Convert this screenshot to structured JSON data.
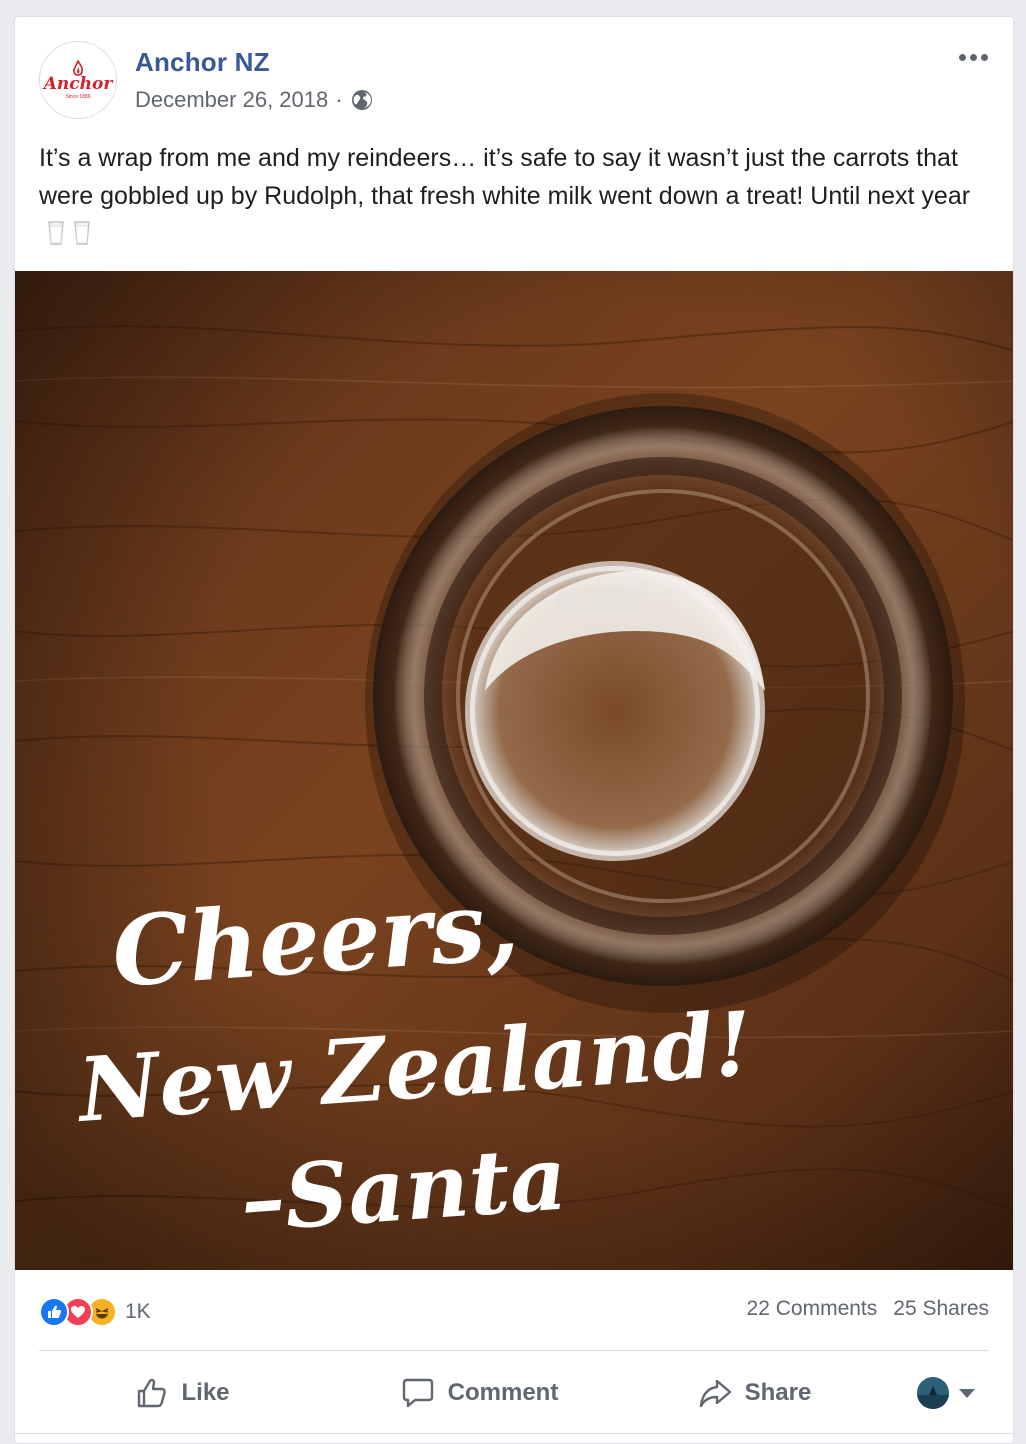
{
  "post": {
    "page_name": "Anchor NZ",
    "date": "December 26, 2018",
    "separator": "·",
    "privacy_icon": "globe-icon",
    "avatar": {
      "brand": "Anchor",
      "tagline": "Since 1886",
      "color": "#d6202b"
    },
    "text": "It’s a wrap from me and my reindeers… it’s safe to say it wasn’t just the carrots that were gobbled up by Rudolph, that fresh white milk went down a treat! Until next year",
    "text_emoji": [
      "glass-of-milk-icon",
      "glass-of-milk-icon"
    ]
  },
  "photo": {
    "overlay_line1": "Cheers,",
    "overlay_line2": "New Zealand!",
    "overlay_line3": "–Santa"
  },
  "engagement": {
    "reaction_icons": [
      "like-icon",
      "love-icon",
      "haha-icon"
    ],
    "reaction_count": "1K",
    "comments": "22 Comments",
    "shares": "25 Shares"
  },
  "actions": {
    "like": "Like",
    "comment": "Comment",
    "share": "Share"
  },
  "colors": {
    "link_blue": "#385898",
    "secondary_text": "#606770",
    "like_blue": "#1877f2",
    "love_red": "#f33e58",
    "haha_yellow": "#f7b125"
  }
}
